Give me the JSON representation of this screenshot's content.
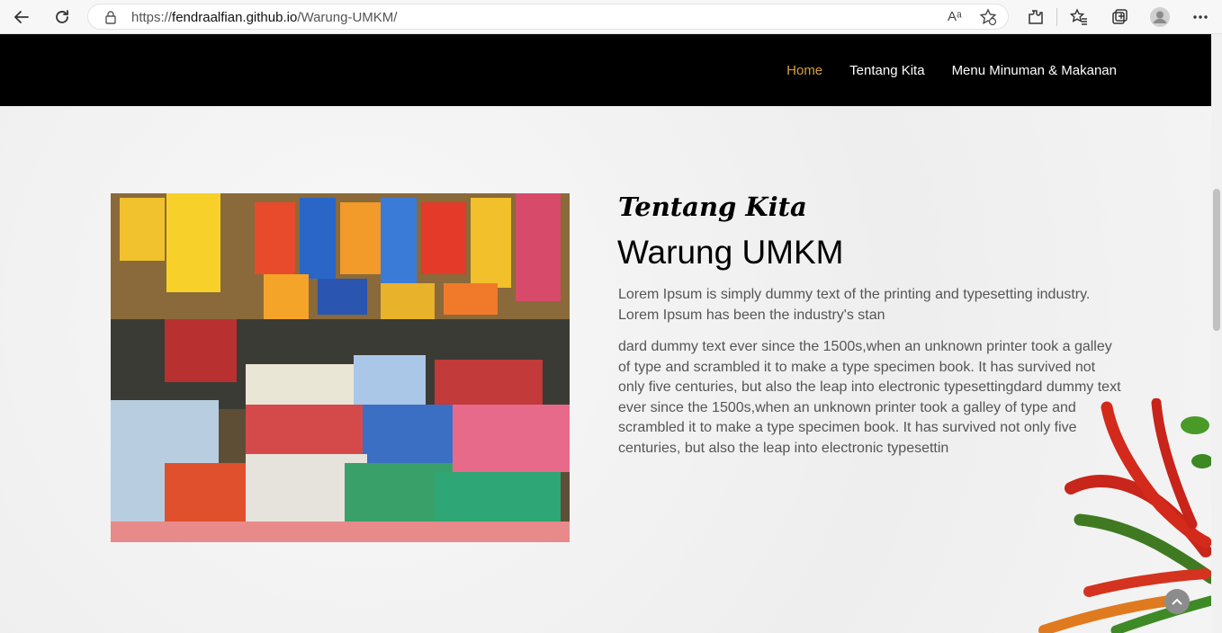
{
  "browser": {
    "url_prefix": "https://",
    "url_host": "fendraalfian.github.io",
    "url_path": "/Warung-UMKM/",
    "read_aloud": "Aᵃ"
  },
  "nav": {
    "items": [
      "Home",
      "Tentang Kita",
      "Menu Minuman & Makanan"
    ],
    "active_color": "#d7a03a"
  },
  "about": {
    "script_title": "Tentang Kita",
    "title": "Warung UMKM",
    "paragraph1": "Lorem Ipsum is simply dummy text of the printing and typesetting industry. Lorem Ipsum has been the industry's stan",
    "paragraph2": "dard dummy text ever since the 1500s,when an unknown printer took a galley of type and scrambled it to make a type specimen book. It has survived not only five centuries, but also the leap into electronic typesettingdard dummy text ever since the 1500s,when an unknown printer took a galley of type and scrambled it to make a type specimen book. It has survived not only five centuries, but also the leap into electronic typesettin"
  },
  "colors": {
    "header_bg": "#000000",
    "accent": "#d7a03a"
  }
}
